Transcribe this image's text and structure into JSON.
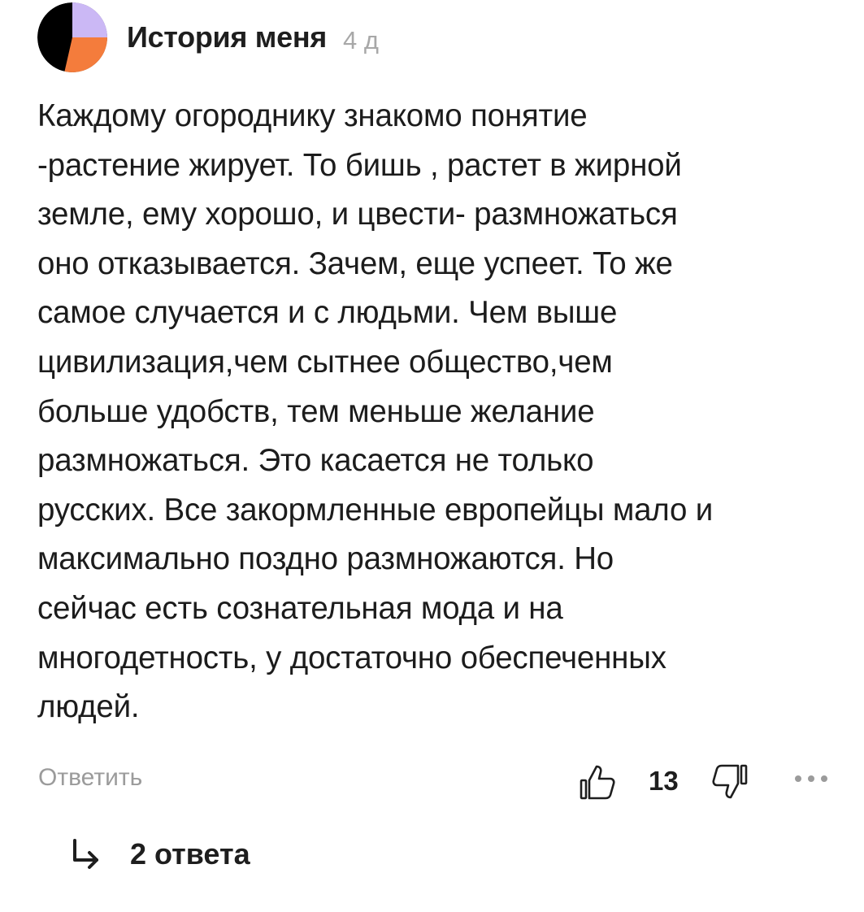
{
  "comment": {
    "author": "История меня",
    "time": "4 д",
    "text": "Каждому огороднику знакомо понятие\n-растение жирует. То бишь , растет в жирной\nземле, ему хорошо, и цвести- размножаться\nоно отказывается. Зачем, еще успеет. То же\nсамое случается и с людьми. Чем выше\nцивилизация,чем сытнее общество,чем\nбольше удобств, тем меньше желание\nразмножаться. Это касается не только\nрусских. Все закормленные европейцы мало и\nмаксимально поздно размножаются. Но\nсейчас есть сознательная мода и на\nмногодетность, у достаточно обеспеченных\nлюдей.",
    "avatar_colors": {
      "background": "#000000",
      "top_right": "#cbb8f5",
      "bottom": "#f47c3c"
    }
  },
  "actions": {
    "reply_label": "Ответить",
    "like_count": "13",
    "like_icon": "thumbs-up-outline-icon",
    "dislike_icon": "thumbs-down-outline-icon",
    "more_icon": "more-dots-icon"
  },
  "replies": {
    "label": "2 ответа",
    "icon": "reply-arrow-icon"
  }
}
